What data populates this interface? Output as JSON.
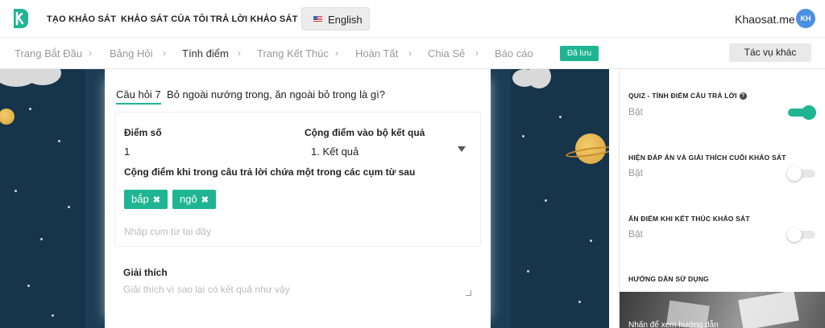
{
  "nav": {
    "links": [
      "TẠO KHẢO SÁT",
      "KHẢO SÁT CỦA TÔI",
      "TRẢ LỜI KHẢO SÁT"
    ],
    "language": "English",
    "site_name": "Khaosat.me",
    "avatar_initials": "KH",
    "brand_color": "#1fb592"
  },
  "steps": {
    "items": [
      "Trang Bắt Đầu",
      "Bảng Hỏi",
      "Tính điểm",
      "Trang Kết Thúc",
      "Hoàn Tất",
      "Chia Sẻ",
      "Báo cáo"
    ],
    "active": "Tính điểm",
    "saved_badge": "Đã lưu",
    "other_task": "Tác vụ khác"
  },
  "question": {
    "number_label": "Câu hỏi 7",
    "text": "Bỏ ngoài nướng trong, ăn ngoài bỏ trong là gì?",
    "score_label": "Điểm số",
    "score_value": "1",
    "add_to_set_label": "Cộng điểm vào bộ kết quả",
    "add_to_set_value": "1. Kết quả",
    "phrase_rule_label": "Cộng điểm khi trong câu trả lời chứa một trong các cụm từ sau",
    "tags": [
      "bắp",
      "ngô"
    ],
    "phrase_placeholder": "Nhập cụm từ tại đây",
    "explain_label": "Giải thích",
    "explain_placeholder": "Giải thích vì sao lại có kết quả như vậy"
  },
  "sidebar": {
    "settings": [
      {
        "title": "QUIZ - TÍNH ĐIỂM CÂU TRẢ LỜI",
        "state": "Bật",
        "on": true
      },
      {
        "title": "HIỆN ĐÁP ÁN VÀ GIẢI THÍCH CUỐI KHẢO SÁT",
        "state": "Bật",
        "on": false
      },
      {
        "title": "ẨN ĐIỂM KHI KẾT THÚC KHẢO SÁT",
        "state": "Bật",
        "on": false
      }
    ],
    "guide_title": "HƯỚNG DẪN SỬ DỤNG",
    "guide_caption": "Nhấn để xem hướng dẫn"
  }
}
